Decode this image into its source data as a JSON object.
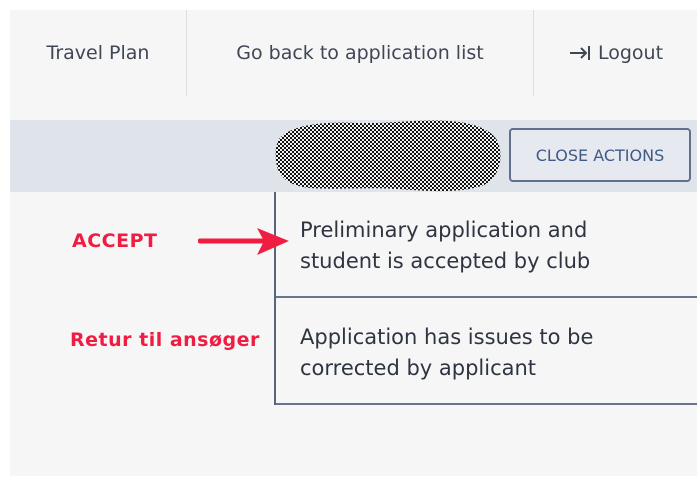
{
  "nav": {
    "items": [
      {
        "label": "Travel Plan"
      },
      {
        "label": "Go back to application list"
      },
      {
        "label": "Logout",
        "icon": "logout-arrow-icon"
      }
    ]
  },
  "actions": {
    "close_button_label": "CLOSE ACTIONS"
  },
  "action_menu": {
    "items": [
      {
        "label_line1": "Preliminary application and",
        "label_line2": "student is accepted by club"
      },
      {
        "label_line1": "Application has issues to be",
        "label_line2": "corrected by applicant"
      }
    ]
  },
  "annotations": {
    "accept": "ACCEPT",
    "return_to_applicant": "Retur til ansøger"
  },
  "colors": {
    "annotation_red": "#f01d42",
    "nav_text": "#3f4654",
    "button_text": "#3f5a87",
    "actions_bar": "#dfe3ea",
    "background": "#f6f6f7"
  }
}
